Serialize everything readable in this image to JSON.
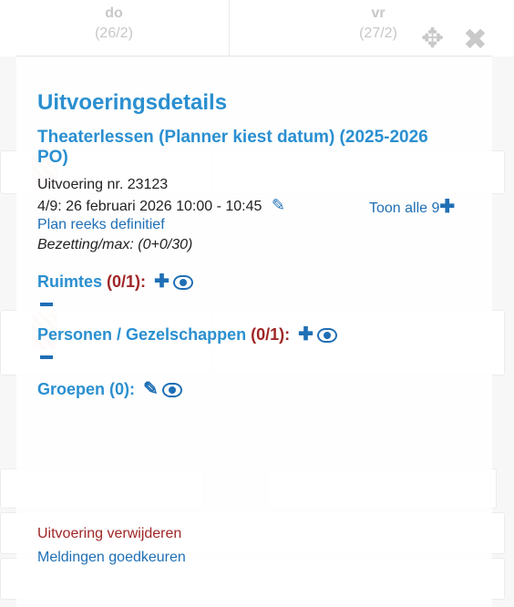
{
  "calendar": {
    "day_do": {
      "name": "do",
      "date": "(26/2)"
    },
    "day_vr": {
      "name": "vr",
      "date": "(27/2)"
    }
  },
  "popup": {
    "title": "Uitvoeringsdetails",
    "subtitle": "Theaterlessen (Planner kiest datum) (2025-2026 PO)",
    "performance_nr": "Uitvoering nr. 23123",
    "datetime": "4/9: 26 februari 2026 10:00 - 10:45",
    "show_all": "Toon alle 9",
    "plan_link": "Plan reeks definitief",
    "occupancy": "Bezetting/max: (0+0/30)",
    "rooms": {
      "label": "Ruimtes",
      "count": "(0/1):"
    },
    "persons": {
      "label": "Personen / Gezelschappen",
      "count": "(0/1):"
    },
    "groups": {
      "label": "Groepen (0):"
    },
    "delete_link": "Uitvoering verwijderen",
    "approve_link": "Meldingen goedkeuren"
  },
  "icons": {
    "move": "move-icon",
    "close": "close-icon",
    "edit": "pencil-icon",
    "add": "plus-icon",
    "view": "eye-icon",
    "remove": "minus-icon"
  },
  "colors": {
    "heading_blue": "#2a8fd0",
    "link_blue": "#1f6fb5",
    "danger_red": "#a02626"
  }
}
